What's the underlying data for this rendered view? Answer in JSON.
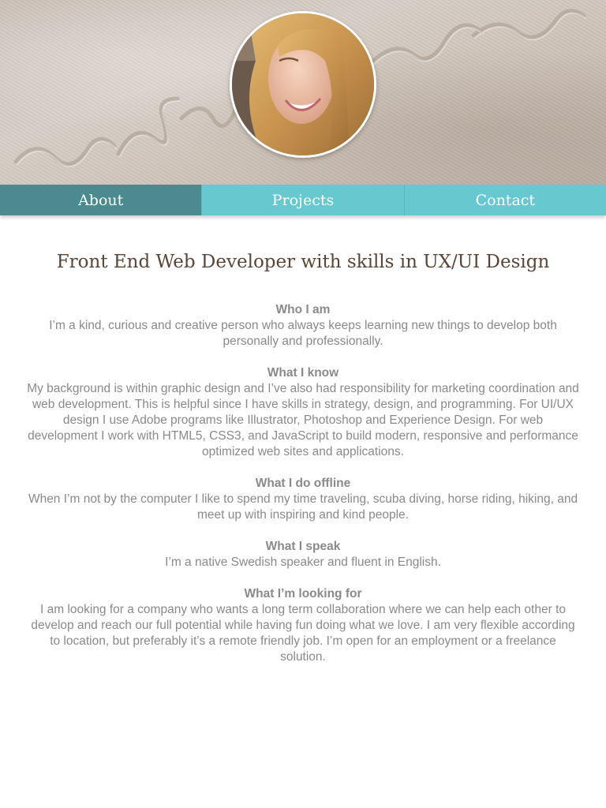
{
  "nav": {
    "items": [
      {
        "label": "About",
        "active": true
      },
      {
        "label": "Projects",
        "active": false
      },
      {
        "label": "Contact",
        "active": false
      }
    ],
    "active_color": "#4b8a8e",
    "color": "#67c8cf"
  },
  "main": {
    "headline": "Front End Web Developer with skills in UX/UI Design",
    "sections": [
      {
        "title": "Who I am",
        "body": "I’m a kind, curious and creative person who always keeps learning new things to develop both personally and professionally."
      },
      {
        "title": "What I know",
        "body": "My background is within graphic design and I’ve also had responsibility for marketing coordination and web development. This is helpful since I have skills in strategy, design, and programming. For UI/UX design I use Adobe programs like Illustrator, Photoshop and Experience Design. For web development I work with HTML5, CSS3, and JavaScript to build modern, responsive and performance optimized web sites and applications."
      },
      {
        "title": "What I do offline",
        "body": "When I’m not by the computer I like to spend my time traveling, scuba diving, horse riding, hiking, and meet up with inspiring and kind people."
      },
      {
        "title": "What I speak",
        "body": "I’m a native Swedish speaker and fluent in English."
      },
      {
        "title": "What I’m looking for",
        "body": "I am looking for a company who wants a long term collaboration where we can help each other to develop and reach our full potential while having fun doing what we love. I am very flexible according to location, but preferably it’s a remote friendly job. I’m open for an employment or a freelance solution."
      }
    ]
  }
}
